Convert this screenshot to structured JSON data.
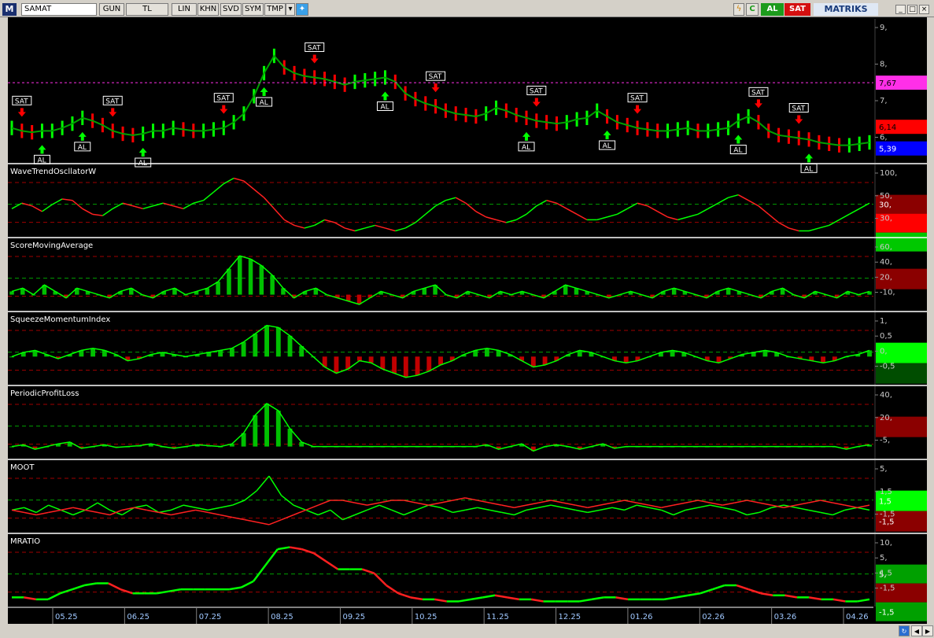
{
  "toolbar": {
    "app_icon": "M",
    "symbol": "SAMAT",
    "buttons": [
      "GUN",
      "TL",
      "LIN",
      "KHN",
      "SVD",
      "SYM",
      "TMP"
    ],
    "buy_label": "AL",
    "sell_label": "SAT",
    "brand": "MATRIKS",
    "colors": {
      "buy": "#1c9b1c",
      "sell": "#d40f0f"
    }
  },
  "chart_data": [
    {
      "type": "line",
      "title": "",
      "yticks": [
        "9,",
        "8,",
        "7,",
        "6,"
      ],
      "ylim": [
        5.0,
        9.5
      ],
      "price_labels": [
        {
          "text": "7,67",
          "value": 7.67,
          "color": "#ff2fe8"
        },
        {
          "text": "6,14",
          "value": 6.14,
          "color": "#ff0000"
        },
        {
          "text": "5,39",
          "value": 5.39,
          "color": "#0000ff"
        }
      ],
      "xticks": [
        "05.25",
        "06.25",
        "07.25",
        "08.25",
        "09.25",
        "10.25",
        "11.25",
        "12.25",
        "01.26",
        "02.26",
        "03.26",
        "04.26"
      ],
      "series": [
        {
          "values": [
            6.1,
            6.0,
            5.95,
            6.0,
            6.0,
            6.1,
            6.25,
            6.45,
            6.35,
            6.2,
            6.0,
            5.9,
            5.85,
            5.9,
            6.0,
            6.0,
            6.1,
            6.05,
            6.0,
            6.0,
            6.05,
            6.1,
            6.3,
            6.6,
            7.2,
            8.0,
            8.6,
            8.2,
            8.0,
            7.9,
            7.85,
            7.8,
            7.7,
            7.6,
            7.7,
            7.75,
            7.8,
            7.85,
            7.7,
            7.3,
            7.1,
            6.95,
            6.85,
            6.7,
            6.6,
            6.55,
            6.5,
            6.6,
            6.8,
            6.7,
            6.55,
            6.45,
            6.35,
            6.3,
            6.25,
            6.3,
            6.4,
            6.45,
            6.7,
            6.5,
            6.3,
            6.2,
            6.1,
            6.05,
            6.0,
            6.0,
            6.05,
            6.1,
            6.0,
            6.0,
            6.05,
            6.1,
            6.35,
            6.5,
            6.3,
            6.0,
            5.85,
            5.8,
            5.75,
            5.7,
            5.6,
            5.55,
            5.5,
            5.5,
            5.55,
            5.6
          ]
        }
      ],
      "buy_labels_text": "AL",
      "sell_labels_text": "SAT",
      "buy_signals": [
        3,
        7,
        13,
        25,
        37,
        51,
        59,
        72,
        79
      ],
      "sell_signals": [
        1,
        10,
        21,
        30,
        42,
        52,
        62,
        74,
        78
      ]
    },
    {
      "type": "line",
      "title": "WaveTrendOscllatorW",
      "yticks": [
        "100,",
        "50,",
        "30,"
      ],
      "ylim": [
        -90,
        120
      ],
      "right_labels": [
        {
          "text": "30,",
          "color": "#8b0000"
        },
        {
          "text": "",
          "color": "#ff0000"
        },
        {
          "text": "",
          "color": "#00c800"
        }
      ],
      "series": [
        {
          "values": [
            0,
            20,
            10,
            -10,
            15,
            35,
            30,
            0,
            -20,
            -25,
            0,
            20,
            10,
            0,
            10,
            20,
            10,
            0,
            20,
            30,
            60,
            90,
            110,
            100,
            70,
            40,
            0,
            -40,
            -60,
            -70,
            -60,
            -40,
            -50,
            -70,
            -80,
            -70,
            -60,
            -70,
            -80,
            -70,
            -50,
            -20,
            10,
            30,
            40,
            20,
            -10,
            -30,
            -40,
            -50,
            -40,
            -20,
            10,
            30,
            20,
            0,
            -20,
            -40,
            -40,
            -30,
            -20,
            0,
            20,
            10,
            -10,
            -30,
            -40,
            -30,
            -20,
            0,
            20,
            40,
            50,
            30,
            10,
            -20,
            -50,
            -70,
            -80,
            -80,
            -70,
            -60,
            -40,
            -20,
            0,
            20
          ]
        }
      ]
    },
    {
      "type": "bar",
      "title": "ScoreMovingAverage",
      "yticks": [
        "60,",
        "40,",
        "20,",
        "-10,"
      ],
      "ylim": [
        -20,
        70
      ],
      "right_labels": [
        {
          "text": "",
          "color": "#8b0000"
        }
      ],
      "series": [
        {
          "values": [
            5,
            10,
            0,
            15,
            5,
            -5,
            10,
            5,
            0,
            -5,
            5,
            10,
            0,
            -5,
            5,
            10,
            0,
            5,
            10,
            20,
            40,
            60,
            55,
            45,
            30,
            10,
            -5,
            5,
            10,
            0,
            -5,
            -10,
            -15,
            -5,
            5,
            0,
            -5,
            5,
            10,
            15,
            0,
            -5,
            5,
            0,
            -5,
            5,
            0,
            5,
            0,
            -5,
            5,
            15,
            10,
            5,
            0,
            -5,
            0,
            5,
            0,
            -5,
            5,
            10,
            5,
            0,
            -5,
            5,
            10,
            5,
            0,
            -5,
            5,
            10,
            0,
            -5,
            5,
            0,
            -5,
            5,
            0,
            5
          ]
        }
      ]
    },
    {
      "type": "bar",
      "title": "SqueezeMomentumIndex",
      "yticks": [
        "1,",
        "0,5",
        "0,",
        "-0,5"
      ],
      "ylim": [
        -1.2,
        1.6
      ],
      "right_labels": [
        {
          "text": "",
          "color": "#00ff00"
        },
        {
          "text": "",
          "color": "#004d00"
        }
      ],
      "series": [
        {
          "values": [
            0,
            0.2,
            0.3,
            0.1,
            -0.1,
            0.1,
            0.3,
            0.4,
            0.3,
            0.1,
            -0.2,
            -0.1,
            0.1,
            0.2,
            0.1,
            0,
            0.1,
            0.2,
            0.3,
            0.4,
            0.7,
            1.1,
            1.5,
            1.4,
            1.0,
            0.5,
            0,
            -0.5,
            -0.8,
            -0.6,
            -0.2,
            -0.3,
            -0.6,
            -0.8,
            -1.0,
            -0.9,
            -0.7,
            -0.4,
            -0.2,
            0.1,
            0.3,
            0.4,
            0.3,
            0.1,
            -0.2,
            -0.5,
            -0.4,
            -0.2,
            0.1,
            0.3,
            0.2,
            0,
            -0.2,
            -0.3,
            -0.2,
            0,
            0.2,
            0.3,
            0.2,
            0,
            -0.2,
            -0.3,
            -0.1,
            0.1,
            0.2,
            0.3,
            0.2,
            0,
            -0.1,
            -0.2,
            -0.3,
            -0.2,
            0,
            0.1,
            0.3
          ]
        }
      ]
    },
    {
      "type": "bar",
      "title": "PeriodicProfitLoss",
      "yticks": [
        "40,",
        "20,",
        "-5,"
      ],
      "ylim": [
        -10,
        55
      ],
      "right_labels": [
        {
          "text": "",
          "color": "#8b0000"
        }
      ],
      "series": [
        {
          "values": [
            0,
            2,
            -3,
            0,
            3,
            5,
            -2,
            0,
            2,
            -1,
            0,
            1,
            3,
            0,
            -2,
            0,
            2,
            1,
            0,
            3,
            15,
            35,
            48,
            40,
            20,
            5,
            0,
            0,
            0,
            0,
            0,
            0,
            0,
            0,
            0,
            0,
            0,
            0,
            0,
            0,
            0,
            2,
            -3,
            0,
            3,
            -5,
            0,
            2,
            0,
            -3,
            0,
            3,
            -2,
            0,
            0,
            0,
            0,
            0,
            0,
            0,
            0,
            0,
            0,
            0,
            0,
            0,
            0,
            0,
            0,
            0,
            0,
            0,
            -3,
            0,
            2
          ]
        }
      ]
    },
    {
      "type": "line",
      "title": "MOOT",
      "yticks": [
        "5,",
        "1,5",
        "-1,5"
      ],
      "ylim": [
        -4,
        8
      ],
      "right_labels": [
        {
          "text": "1,5",
          "color": "#00ff00"
        },
        {
          "text": "-1,5",
          "color": "#8b0000"
        }
      ],
      "series": [
        {
          "values": [
            0,
            0.5,
            -0.5,
            1,
            0,
            -1,
            0,
            1.5,
            0,
            -1,
            0.5,
            1,
            -0.5,
            0,
            1,
            0.5,
            0,
            0.5,
            1,
            2,
            4,
            7,
            3,
            1,
            0,
            -1,
            0,
            -2,
            -1,
            0,
            1,
            0,
            -1,
            0,
            1,
            0.5,
            -0.5,
            0,
            0.5,
            0,
            -0.5,
            -1,
            0,
            0.5,
            1,
            0.5,
            0,
            -0.5,
            0,
            0.5,
            0,
            1,
            0.5,
            0,
            -1,
            0,
            0.5,
            1,
            0.5,
            0,
            -1,
            -0.5,
            0.5,
            1,
            0.5,
            0,
            -0.5,
            -1,
            0,
            0.5,
            0
          ]
        },
        {
          "values": [
            0,
            -0.5,
            -1,
            -0.5,
            0,
            0.5,
            0,
            -0.5,
            -1,
            0,
            0.5,
            0,
            -0.5,
            -1,
            -0.5,
            0,
            -0.5,
            -1,
            -1.5,
            -2,
            -2.5,
            -3,
            -2,
            -1,
            0,
            1,
            2,
            2,
            1.5,
            1,
            1.5,
            2,
            2,
            1.5,
            1,
            1.5,
            2,
            2.5,
            2,
            1.5,
            1,
            0.5,
            1,
            1.5,
            2,
            1.5,
            1,
            0.5,
            1,
            1.5,
            2,
            1.5,
            1,
            0.5,
            1,
            1.5,
            2,
            1.5,
            1,
            1.5,
            2,
            1.5,
            1,
            0.5,
            1,
            1.5,
            2,
            1.5,
            1,
            0.5,
            1
          ]
        }
      ]
    },
    {
      "type": "line",
      "title": "MRATIO",
      "yticks": [
        "10,",
        "5,",
        "1,5",
        "-1,5"
      ],
      "ylim": [
        -2.5,
        12
      ],
      "right_labels": [
        {
          "text": "5,",
          "color": "#00a000"
        },
        {
          "text": "",
          "color": "#8b0000"
        },
        {
          "text": "-1,5",
          "color": "#00a000"
        }
      ],
      "series": [
        {
          "values": [
            -1,
            -1,
            -1.5,
            -1.5,
            0,
            1,
            2,
            2.5,
            2.5,
            1,
            0,
            0,
            0,
            0.5,
            1,
            1,
            1,
            1,
            1,
            1.5,
            3,
            7,
            11,
            11.5,
            11,
            10,
            8,
            6,
            6,
            6,
            5,
            2,
            0,
            -1,
            -1.5,
            -1.5,
            -2,
            -2,
            -1.5,
            -1,
            -0.5,
            -1,
            -1.5,
            -1.5,
            -2,
            -2,
            -2,
            -2,
            -1.5,
            -1,
            -1,
            -1.5,
            -1.5,
            -1.5,
            -1.5,
            -1,
            -0.5,
            0,
            1,
            2,
            2,
            1,
            0,
            -0.5,
            -0.5,
            -1,
            -1,
            -1.5,
            -1.5,
            -2,
            -2,
            -1.5
          ]
        }
      ]
    }
  ]
}
